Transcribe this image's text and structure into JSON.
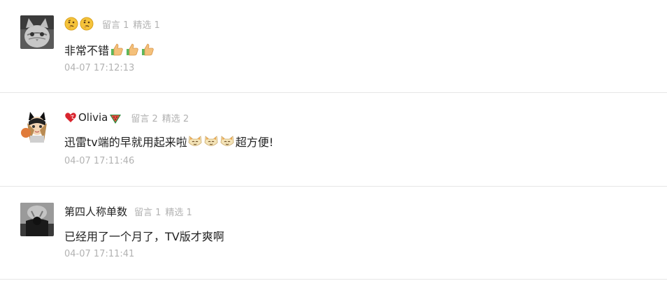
{
  "comments": [
    {
      "name": "",
      "name_icons": [
        "thinking-face-icon",
        "thinking-face-icon"
      ],
      "replies_label": "留言 1",
      "featured_label": "精选 1",
      "text": "非常不错",
      "text_icons": [
        "thumbs-up-icon",
        "thumbs-up-icon",
        "thumbs-up-icon"
      ],
      "time": "04-07 17:12:13",
      "avatar": "cat-avatar"
    },
    {
      "name": "Olivia",
      "name_prefix_icon": "heart-icon",
      "name_suffix_icon": "watermelon-icon",
      "replies_label": "留言 2",
      "featured_label": "精选 2",
      "text_before": "迅雷tv端的早就用起来啦",
      "text_icons": [
        "cat-face-icon",
        "cat-face-icon",
        "cat-face-icon"
      ],
      "text_after": "超方便!",
      "time": "04-07 17:11:46",
      "avatar": "anime-avatar"
    },
    {
      "name": "第四人称单数",
      "replies_label": "留言 1",
      "featured_label": "精选 1",
      "text": "已经用了一个月了，TV版才爽啊",
      "time": "04-07 17:11:41",
      "avatar": "dark-avatar"
    }
  ],
  "colors": {
    "meta": "#b2b2b2",
    "divider": "#e6e6e6",
    "text": "#222222"
  }
}
